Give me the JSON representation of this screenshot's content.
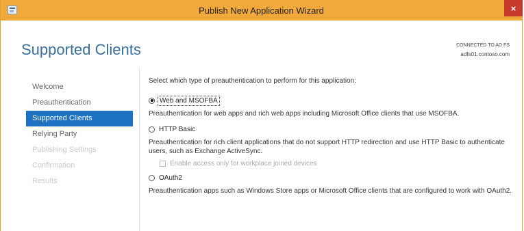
{
  "window": {
    "title": "Publish New Application Wizard",
    "close_glyph": "×",
    "icon": "wizard-app-icon",
    "accent": "#f2a93b",
    "close_color": "#c8392b"
  },
  "header": {
    "title": "Supported Clients",
    "connection_label": "CONNECTED TO AD FS",
    "server": "adfs01.contoso.com"
  },
  "nav": {
    "selected_color": "#1e72c2",
    "items": [
      {
        "label": "Welcome",
        "state": "normal"
      },
      {
        "label": "Preauthentication",
        "state": "normal"
      },
      {
        "label": "Supported Clients",
        "state": "active"
      },
      {
        "label": "Relying Party",
        "state": "normal"
      },
      {
        "label": "Publishing Settings",
        "state": "disabled"
      },
      {
        "label": "Confirmation",
        "state": "disabled"
      },
      {
        "label": "Results",
        "state": "disabled"
      }
    ]
  },
  "content": {
    "prompt": "Select which type of preauthentication to perform for this application:",
    "options": [
      {
        "label": "Web and MSOFBA",
        "checked": true,
        "description": "Preauthentication for web apps and rich web apps including Microsoft Office clients that use MSOFBA."
      },
      {
        "label": "HTTP Basic",
        "checked": false,
        "description": "Preauthentication for rich client applications that do not support HTTP redirection and use HTTP Basic to authenticate users, such as Exchange ActiveSync.",
        "sub_checkbox": {
          "label": "Enable access only for workplace joined devices",
          "checked": false,
          "enabled": false
        }
      },
      {
        "label": "OAuth2",
        "checked": false,
        "description": "Preauthentication apps such as Windows Store apps or Microsoft Office clients that are configured to work with OAuth2."
      }
    ]
  }
}
